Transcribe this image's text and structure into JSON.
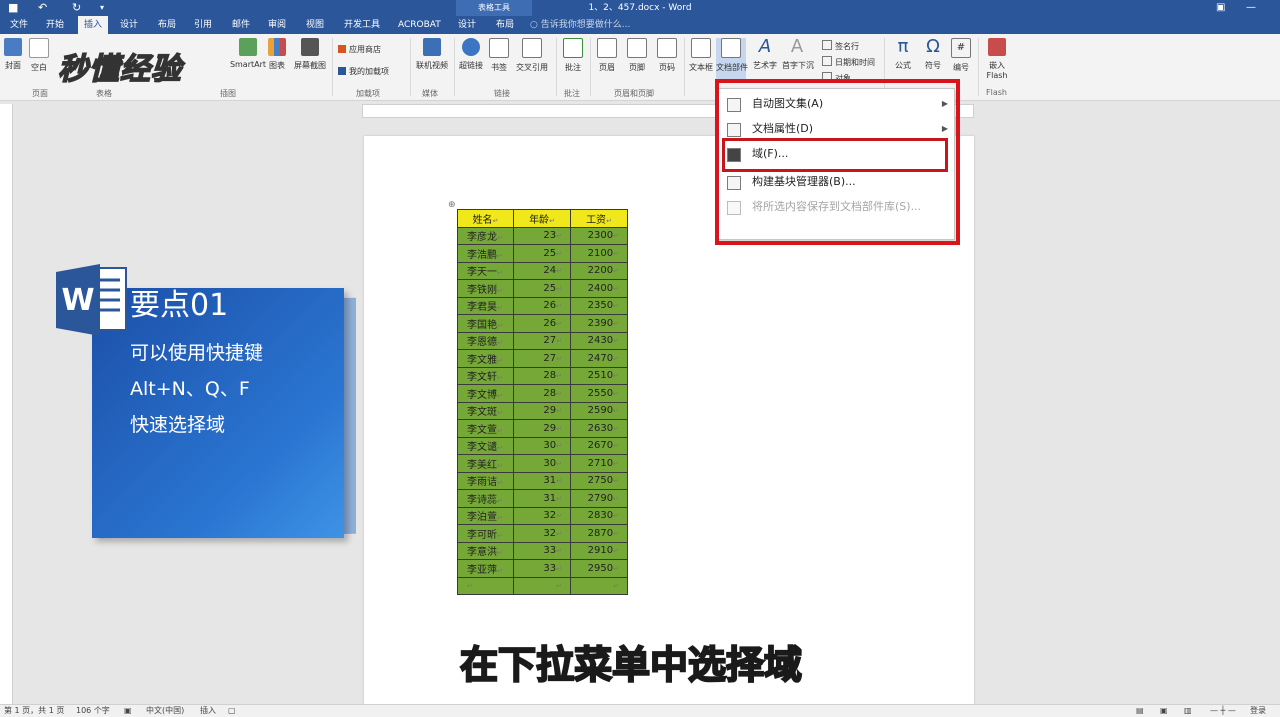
{
  "titlebar": {
    "doc_title": "1、2、457.docx - Word",
    "context_tab": "表格工具",
    "undo_glyph": "↶",
    "redo_glyph": "↻",
    "save_glyph": "💾"
  },
  "tabs": {
    "file": "文件",
    "home": "开始",
    "insert": "插入",
    "design": "设计",
    "layout": "布局",
    "references": "引用",
    "mailings": "邮件",
    "review": "审阅",
    "view": "视图",
    "developer": "开发工具",
    "acrobat": "ACROBAT",
    "table_design": "设计",
    "table_layout": "布局",
    "tell_me": "告诉我你想要做什么..."
  },
  "ribbon": {
    "cover": "封面",
    "blank": "空白",
    "smartart": "SmartArt",
    "chart": "图表",
    "screenshot": "屏幕截图",
    "store": "应用商店",
    "my_addins": "我的加载项",
    "online_video": "联机视频",
    "hyperlink": "超链接",
    "bookmark": "书签",
    "cross_ref": "交叉引用",
    "comment": "批注",
    "header": "页眉",
    "footer": "页脚",
    "page_number": "页码",
    "textbox": "文本框",
    "quickparts": "文档部件",
    "wordart": "艺术字",
    "dropcap": "首字下沉",
    "signature": "签名行",
    "datetime": "日期和时间",
    "object": "对象",
    "equation": "公式",
    "symbol": "符号",
    "number": "编号",
    "flash_line1": "嵌入",
    "flash_line2": "Flash",
    "groups": {
      "pages": "页面",
      "tables": "表格",
      "illustrations": "插图",
      "addins": "加载项",
      "media": "媒体",
      "links": "链接",
      "comments": "批注",
      "header_footer": "页眉和页脚",
      "flash": "Flash"
    }
  },
  "dropdown": {
    "items": [
      {
        "label": "自动图文集(A)",
        "has_submenu": true
      },
      {
        "label": "文档属性(D)",
        "has_submenu": true
      },
      {
        "label": "域(F)..."
      },
      {
        "label": "构建基块管理器(B)..."
      },
      {
        "label": "将所选内容保存到文档部件库(S)...",
        "disabled": true
      }
    ],
    "arrow": "▶"
  },
  "table": {
    "headers": [
      "姓名",
      "年龄",
      "工资"
    ],
    "rows": [
      [
        "李彦龙",
        "23",
        "2300"
      ],
      [
        "李浩鹏",
        "25",
        "2100"
      ],
      [
        "李天一",
        "24",
        "2200"
      ],
      [
        "李铁刚",
        "25",
        "2400"
      ],
      [
        "李君昊",
        "26",
        "2350"
      ],
      [
        "李国艳",
        "26",
        "2390"
      ],
      [
        "李恩德",
        "27",
        "2430"
      ],
      [
        "李文雅",
        "27",
        "2470"
      ],
      [
        "李文轩",
        "28",
        "2510"
      ],
      [
        "李文博",
        "28",
        "2550"
      ],
      [
        "李文斑",
        "29",
        "2590"
      ],
      [
        "李文萱",
        "29",
        "2630"
      ],
      [
        "李文谴",
        "30",
        "2670"
      ],
      [
        "李美红",
        "30",
        "2710"
      ],
      [
        "李雨诘",
        "31",
        "2750"
      ],
      [
        "李诗蕊",
        "31",
        "2790"
      ],
      [
        "李泊萱",
        "32",
        "2830"
      ],
      [
        "李可昕",
        "32",
        "2870"
      ],
      [
        "李意洪",
        "33",
        "2910"
      ],
      [
        "李亚萍",
        "33",
        "2950"
      ],
      [
        "",
        "",
        ""
      ]
    ],
    "mark": "↵",
    "colors": {
      "header_bg": "#f0e81a",
      "cell_bg": "#76a838"
    }
  },
  "card": {
    "title": "要点01",
    "lines": [
      "可以使用快捷键",
      "Alt+N、Q、F",
      "快速选择域"
    ],
    "logo_letter": "W"
  },
  "watermark": "秒懂经验",
  "subtitle": "在下拉菜单中选择域",
  "statusbar": {
    "page": "第 1 页，共 1 页",
    "words": "106 个字",
    "lang": "中文(中国)",
    "mode": "插入",
    "zoom_label": "登录"
  }
}
